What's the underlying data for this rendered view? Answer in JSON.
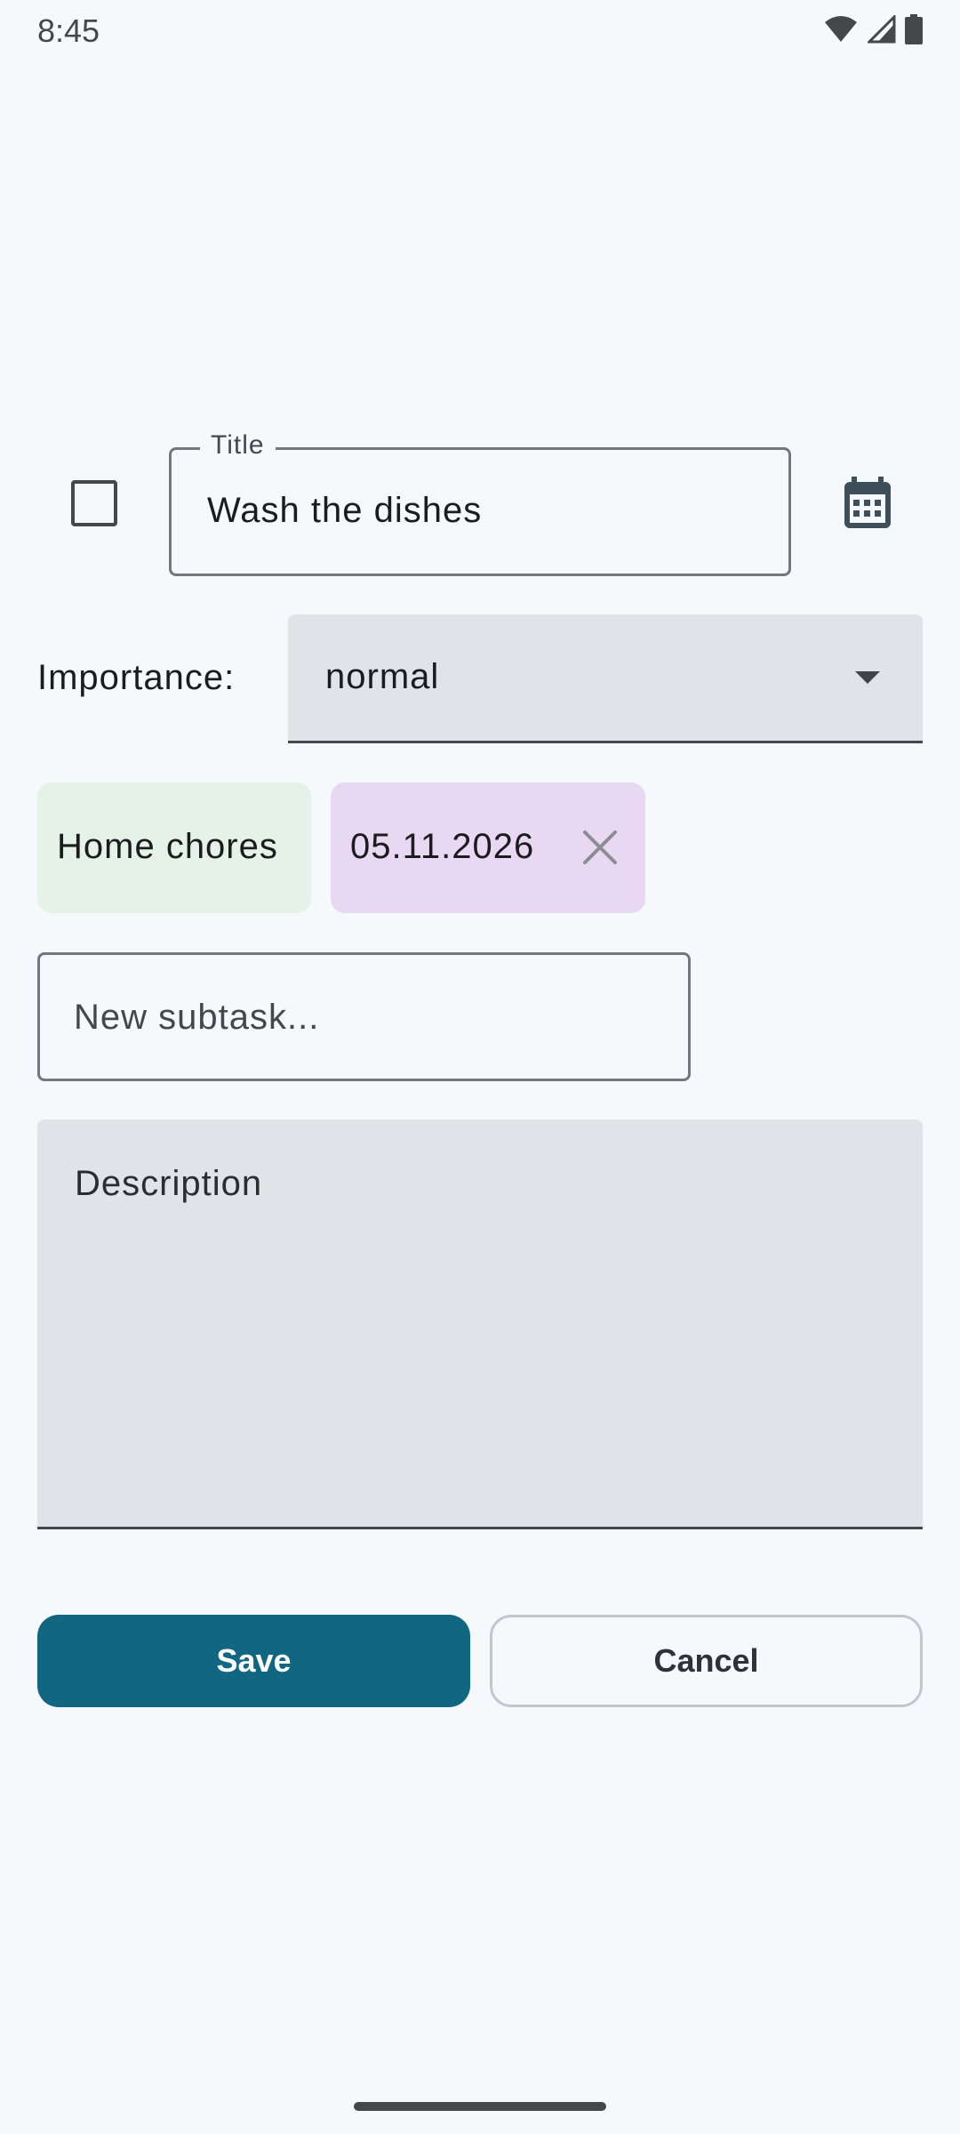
{
  "status_bar": {
    "time": "8:45",
    "icons": [
      "wifi-icon",
      "cell-signal-icon",
      "battery-icon"
    ]
  },
  "task": {
    "completed": false,
    "title_label": "Title",
    "title_value": "Wash the dishes"
  },
  "importance": {
    "label": "Importance:",
    "selected": "normal"
  },
  "chips": {
    "category": "Home chores",
    "date": "05.11.2026"
  },
  "subtask": {
    "placeholder": "New subtask..."
  },
  "description": {
    "placeholder": "Description"
  },
  "actions": {
    "save_label": "Save",
    "cancel_label": "Cancel"
  },
  "colors": {
    "background": "#f5f9fc",
    "primary": "#116782",
    "category_chip": "#e5f2e8",
    "date_chip": "#e8d8f2",
    "filled_field": "#e0e3e8"
  }
}
